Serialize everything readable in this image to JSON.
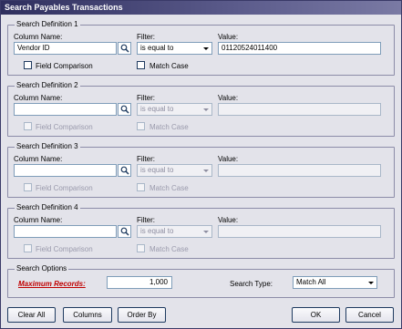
{
  "window": {
    "title": "Search Payables Transactions"
  },
  "labels": {
    "column_name": "Column Name:",
    "filter": "Filter:",
    "value": "Value:",
    "field_comparison": "Field Comparison",
    "match_case": "Match Case"
  },
  "definitions": [
    {
      "title": "Search Definition 1",
      "column": "Vendor ID",
      "filter": "is equal to",
      "value": "01120524011400",
      "enabled": true
    },
    {
      "title": "Search Definition 2",
      "column": "",
      "filter": "is equal to",
      "value": "",
      "enabled": false
    },
    {
      "title": "Search Definition 3",
      "column": "",
      "filter": "is equal to",
      "value": "",
      "enabled": false
    },
    {
      "title": "Search Definition 4",
      "column": "",
      "filter": "is equal to",
      "value": "",
      "enabled": false
    }
  ],
  "options": {
    "title": "Search Options",
    "max_records_label": "Maximum Records:",
    "max_records_value": "1,000",
    "search_type_label": "Search Type:",
    "search_type_value": "Match All"
  },
  "buttons": {
    "clear_all": "Clear All",
    "columns": "Columns",
    "order_by": "Order By",
    "ok": "OK",
    "cancel": "Cancel"
  },
  "icons": {
    "lookup": "magnifier-icon",
    "dropdown": "chevron-down-icon"
  }
}
